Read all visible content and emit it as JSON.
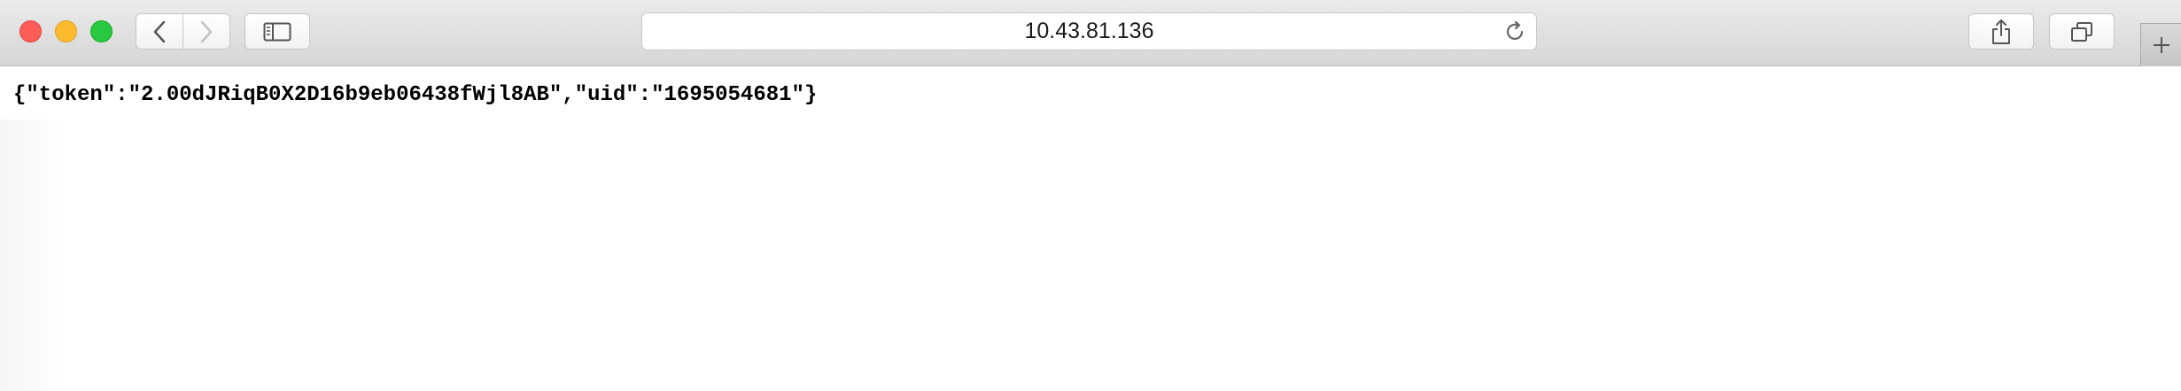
{
  "browser": {
    "address_bar": {
      "url": "10.43.81.136"
    },
    "icons": {
      "back": "chevron-left-icon",
      "forward": "chevron-right-icon",
      "sidebar": "sidebar-icon",
      "reload": "reload-icon",
      "share": "share-icon",
      "tabs": "tabs-overview-icon",
      "new_tab": "plus-icon"
    },
    "traffic_lights": {
      "close_color": "#fd5e57",
      "minimize_color": "#fdbc2e",
      "zoom_color": "#28c840"
    }
  },
  "page": {
    "body_text": "{\"token\":\"2.00dJRiqB0X2D16b9eb06438fWjl8AB\",\"uid\":\"1695054681\"}"
  }
}
